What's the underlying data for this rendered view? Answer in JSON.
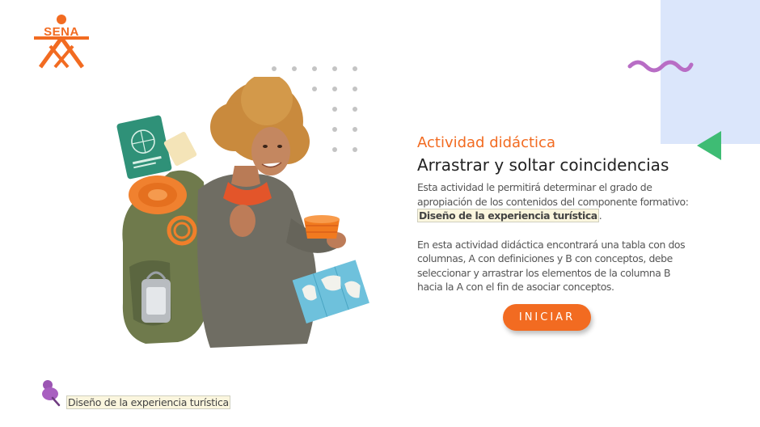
{
  "logo": {
    "text": "SENA",
    "color": "#f26b21"
  },
  "decor": {
    "accent_blue": "#dbe6fb",
    "wave_color": "#b86dc5",
    "triangle_color": "#3ebc74"
  },
  "activity": {
    "label": "Actividad didáctica",
    "title": "Arrastrar y soltar coincidencias",
    "intro_text": "Esta actividad le permitirá determinar el grado de apropiación de los contenidos del componente formativo:",
    "component_name": "Diseño de la experiencia turística",
    "period": ".",
    "instructions": "En esta actividad didáctica encontrará una tabla con dos columnas, A con definiciones y  B con conceptos, debe seleccionar y arrastrar los elementos de la columna  B hacia la A con el fin de asociar conceptos."
  },
  "start_button": {
    "label": "INICIAR",
    "color": "#f26b21"
  },
  "footer": {
    "icon": "pushpin-icon",
    "label": "Diseño de la experiencia turística"
  }
}
